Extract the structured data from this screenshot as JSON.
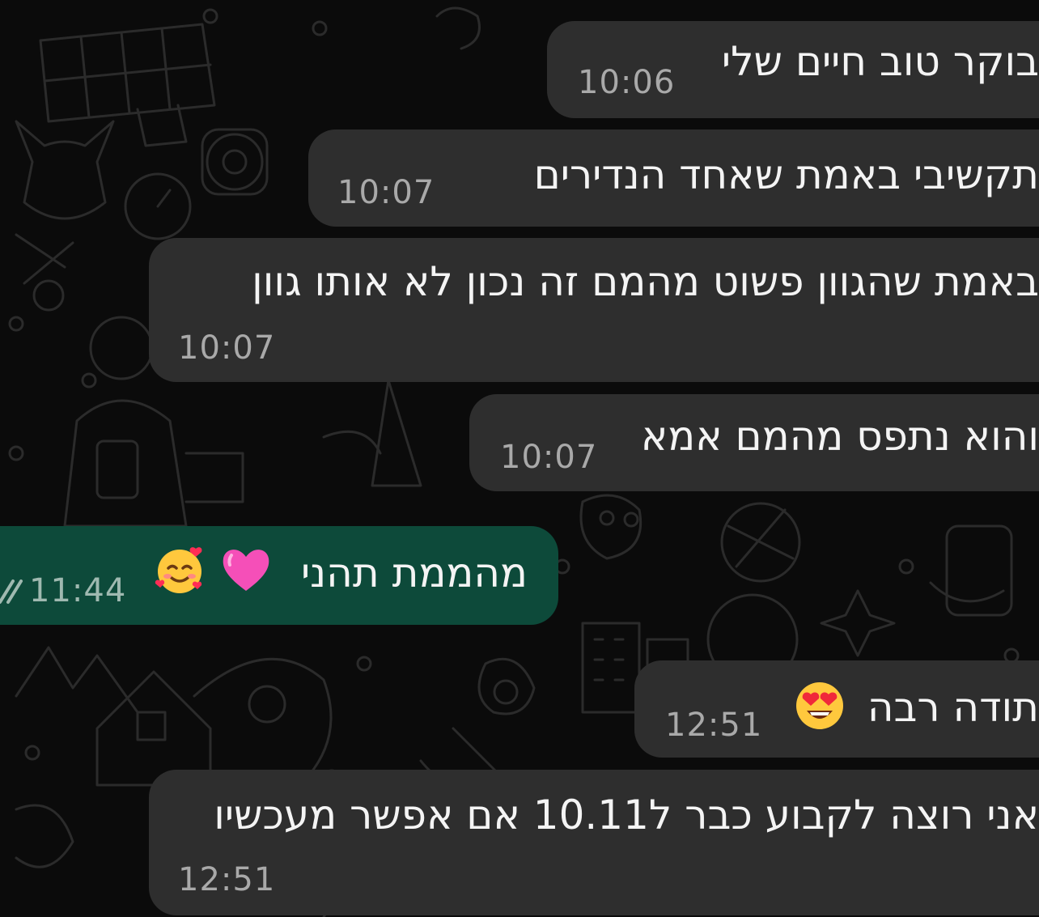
{
  "chat": {
    "messages": [
      {
        "direction": "incoming",
        "text": "בוקר טוב חיים שלי",
        "time": "10:06"
      },
      {
        "direction": "incoming",
        "text": "תקשיבי באמת שאחד הנדירים",
        "time": "10:07"
      },
      {
        "direction": "incoming",
        "text": "באמת שהגוון פשוט מהמם זה נכון לא אותו גוון",
        "time": "10:07"
      },
      {
        "direction": "incoming",
        "text": "והוא נתפס מהמם אמא",
        "time": "10:07"
      },
      {
        "direction": "outgoing",
        "text": "מהממת תהני",
        "time": "11:44",
        "emojis": [
          "pink-heart-emoji",
          "smiling-face-with-hearts-emoji"
        ],
        "status": "read-ticks"
      },
      {
        "direction": "incoming",
        "text": "תודה רבה",
        "time": "12:51",
        "emojis": [
          "heart-eyes-emoji"
        ]
      },
      {
        "direction": "incoming",
        "text": "אני רוצה לקבוע כבר ל10.11 אם אפשר מעכשיו",
        "time": "12:51"
      }
    ]
  },
  "colors": {
    "background": "#0b0b0b",
    "incoming_bubble": "#2e2e2e",
    "outgoing_bubble": "#0d4a3a",
    "text": "#f4f4f4",
    "time": "#a9a9a9",
    "doodle": "#2a2a2a"
  }
}
